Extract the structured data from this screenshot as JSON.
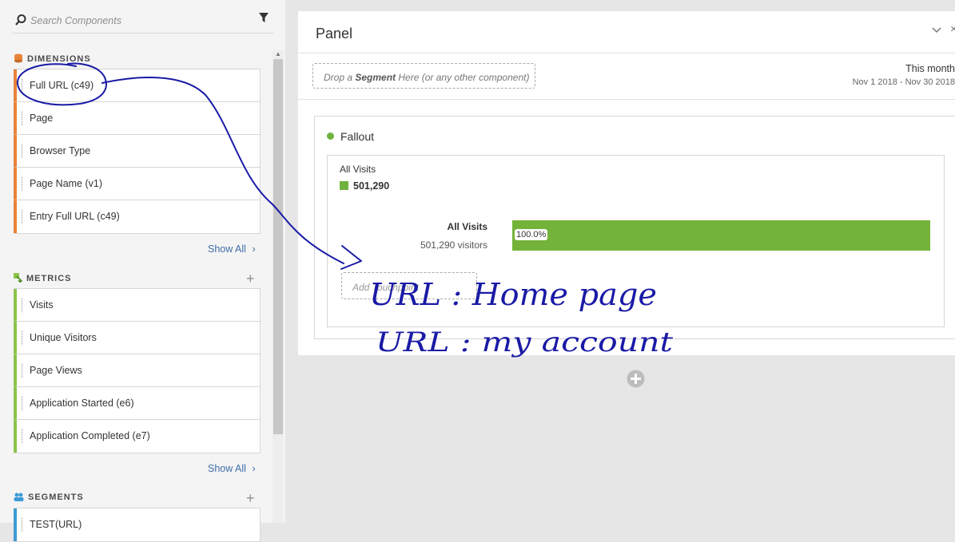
{
  "search": {
    "placeholder": "Search Components"
  },
  "dimensions": {
    "title": "DIMENSIONS",
    "items": [
      {
        "label": "Full URL (c49)"
      },
      {
        "label": "Page"
      },
      {
        "label": "Browser Type"
      },
      {
        "label": "Page Name (v1)"
      },
      {
        "label": "Entry Full URL (c49)"
      }
    ],
    "show_all": "Show All"
  },
  "metrics": {
    "title": "METRICS",
    "items": [
      {
        "label": "Visits"
      },
      {
        "label": "Unique Visitors"
      },
      {
        "label": "Page Views"
      },
      {
        "label": "Application Started (e6)"
      },
      {
        "label": "Application Completed (e7)"
      }
    ],
    "show_all": "Show All"
  },
  "segments": {
    "title": "SEGMENTS",
    "items": [
      {
        "label": "TEST(URL)"
      }
    ]
  },
  "panel": {
    "title": "Panel",
    "segment_drop": {
      "pre": "Drop a ",
      "bold": "Segment",
      "post": " Here (or any other component)"
    },
    "date_label": "This month",
    "date_range": "Nov 1 2018 - Nov 30 2018"
  },
  "fallout": {
    "title": "Fallout",
    "legend_label": "All Visits",
    "legend_value": "501,290",
    "touchpoint_name": "All Visits",
    "touchpoint_visitors": "501,290 visitors",
    "percent_label": "100.0%",
    "percent": 100,
    "add_touchpoint": "Add Touchpoint"
  },
  "annotation": {
    "line1": "URL : Home page",
    "line2": "URL : my account"
  },
  "colors": {
    "dimension": "#e8833a",
    "metric": "#8bc34a",
    "segment": "#3d9bd6",
    "fallout_bar": "#74b33a",
    "ink": "#1a1aa6"
  }
}
